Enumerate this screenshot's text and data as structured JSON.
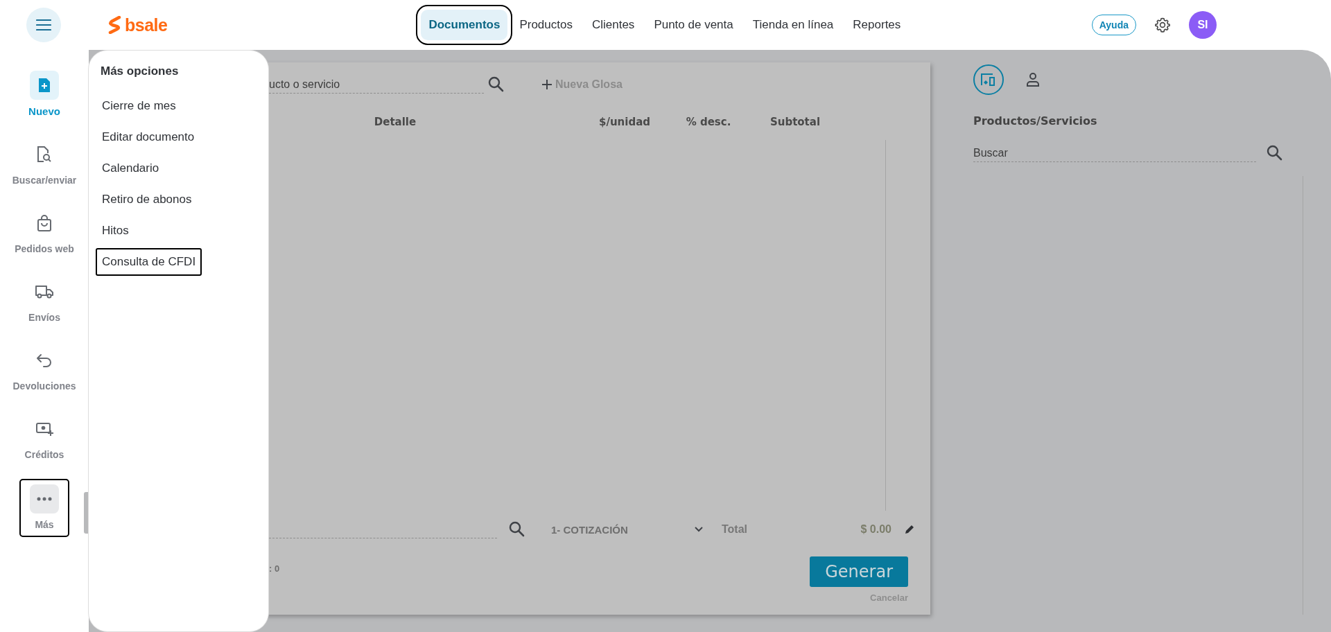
{
  "header": {
    "logo": "bsale",
    "nav": [
      {
        "label": "Documentos",
        "selected": true,
        "focused": true
      },
      {
        "label": "Productos",
        "selected": false,
        "focused": false
      },
      {
        "label": "Clientes",
        "selected": false,
        "focused": false
      },
      {
        "label": "Punto de venta",
        "selected": false,
        "focused": false
      },
      {
        "label": "Tienda en línea",
        "selected": false,
        "focused": false
      },
      {
        "label": "Reportes",
        "selected": false,
        "focused": false
      }
    ],
    "help_button": "Ayuda",
    "avatar": "SI"
  },
  "sidebar": {
    "items": [
      {
        "kind": "new",
        "label": "Nuevo",
        "selected": true,
        "focused": false
      },
      {
        "kind": "search",
        "label": "Buscar/enviar",
        "selected": false,
        "focused": false
      },
      {
        "kind": "orders",
        "label": "Pedidos web",
        "selected": false,
        "focused": false
      },
      {
        "kind": "shipping",
        "label": "Envíos",
        "selected": false,
        "focused": false
      },
      {
        "kind": "returns",
        "label": "Devoluciones",
        "selected": false,
        "focused": false
      },
      {
        "kind": "credits",
        "label": "Créditos",
        "selected": false,
        "focused": false
      },
      {
        "kind": "more",
        "label": "Más",
        "selected": false,
        "focused": true
      }
    ]
  },
  "menu": {
    "title": "Más opciones",
    "items": [
      {
        "label": "Cierre de mes",
        "focused": false
      },
      {
        "label": "Editar documento",
        "focused": false
      },
      {
        "label": "Calendario",
        "focused": false
      },
      {
        "label": "Retiro de abonos",
        "focused": false
      },
      {
        "label": "Hitos",
        "focused": false
      },
      {
        "label": "Consulta de CFDI",
        "focused": true
      }
    ]
  },
  "document": {
    "product_search": {
      "placeholder": "ucto o servicio"
    },
    "new_line_button": "Nueva Glosa",
    "columns": [
      "Detalle",
      "$/unidad",
      "% desc.",
      "Subtotal"
    ],
    "document_type": "1- COTIZACIÓN",
    "total_label": "Total",
    "total_value": "$ 0.00",
    "count_text": ": 0",
    "generate_button": "Generar",
    "cancel_link": "Cancelar"
  },
  "right_panel": {
    "tabs": [
      {
        "kind": "products",
        "selected": true
      },
      {
        "kind": "client",
        "selected": false
      }
    ],
    "heading": "Productos/Servicios",
    "search": {
      "placeholder": "Buscar"
    }
  }
}
